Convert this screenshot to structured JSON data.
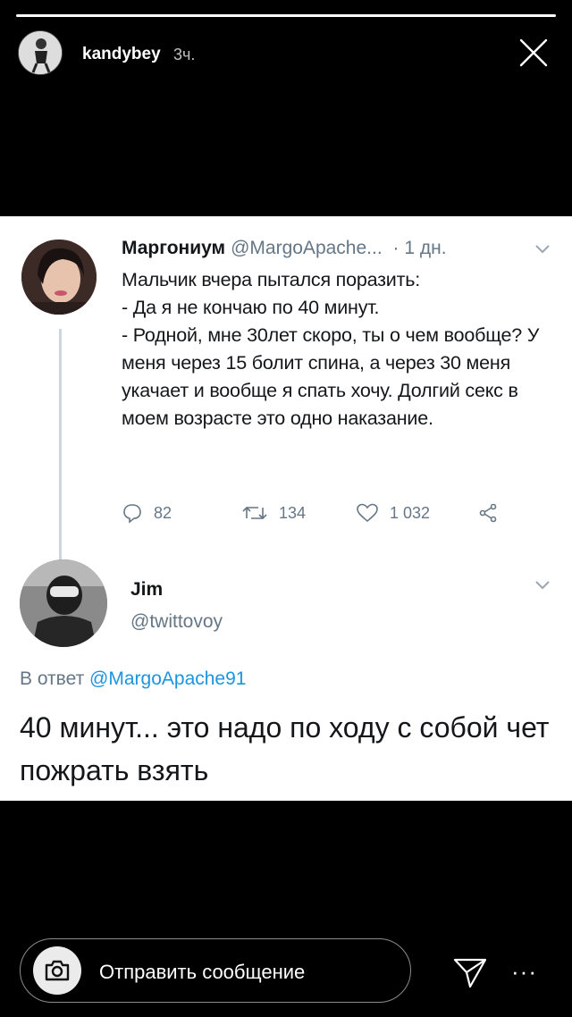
{
  "story": {
    "progress": 1.0,
    "username": "kandybey",
    "time": "3ч."
  },
  "tweet": {
    "name": "Маргониум",
    "handle": "@MargoApache...",
    "time": "· 1 дн.",
    "lines": [
      "Мальчик вчера пытался поразить:",
      "- Да я не кончаю по 40 минут.",
      "- Родной, мне 30лет скоро, ты о чем вообще? У меня через 15 болит спина, а через 30 меня укачает и вообще я спать хочу. Долгий секс в моем возрасте это одно наказание."
    ],
    "replies": "82",
    "retweets": "134",
    "likes": "1 032"
  },
  "reply": {
    "name": "Jim",
    "handle": "@twittovoy",
    "reply_prefix": "В ответ",
    "reply_to": "@MargoApache91",
    "text": "40 минут... это надо по ходу с собой чет пожрать взять"
  },
  "footer": {
    "message_placeholder": "Отправить сообщение",
    "more": "···"
  },
  "icons": {
    "close": "close-icon",
    "camera": "camera-icon",
    "send": "send-icon",
    "reply": "reply-icon",
    "retweet": "retweet-icon",
    "like": "heart-icon",
    "share": "share-icon"
  }
}
